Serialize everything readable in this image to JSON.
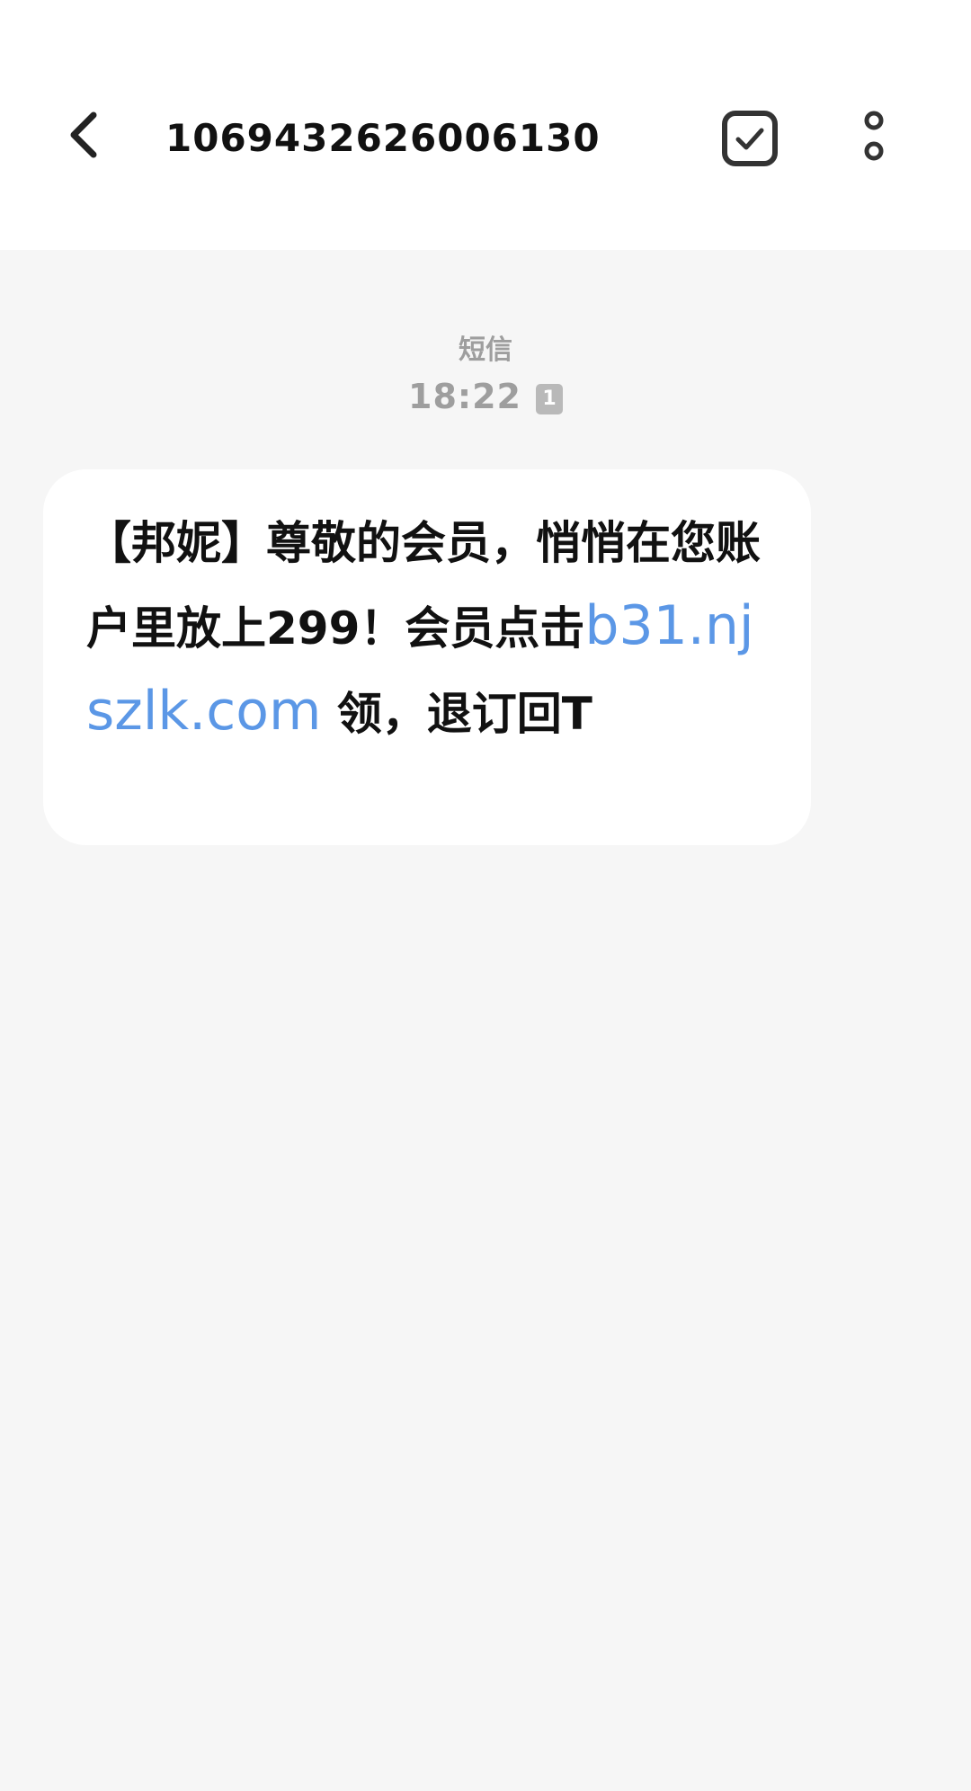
{
  "header": {
    "title": "1069432626006130",
    "back_icon": "chevron-left-icon",
    "select_icon": "checkbox-checked-icon",
    "more_icon": "more-vertical-icon"
  },
  "conversation": {
    "message_type": "短信",
    "time": "18:22",
    "sim_slot": "1"
  },
  "message": {
    "text_before_link": "【邦妮】尊敬的会员，悄悄在您账户里放上299！会员点击",
    "link": "b31.njszlk.com",
    "text_after_link": " 领，退订回T",
    "link_color": "#5b97e6"
  },
  "colors": {
    "background": "#f6f6f6",
    "header": "#ffffff",
    "bubble": "#ffffff",
    "meta_text": "#9e9e9e"
  }
}
